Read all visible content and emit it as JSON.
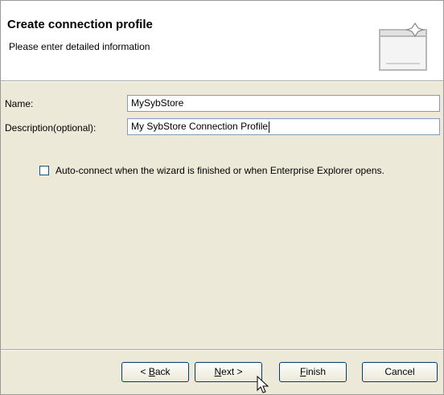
{
  "banner": {
    "title": "Create connection profile",
    "description": "Please enter detailed information",
    "icon": "wizard-banner-icon"
  },
  "form": {
    "name_label": "Name:",
    "name_value": "MySybStore",
    "description_label": "Description(optional):",
    "description_value": "My SybStore Connection Profile",
    "auto_connect_label": "Auto-connect when the wizard is finished or when Enterprise Explorer opens.",
    "auto_connect_checked": false
  },
  "buttons": {
    "back": {
      "mnemonic": "B",
      "rest": "ack",
      "prefix": "< "
    },
    "next": {
      "mnemonic": "N",
      "rest": "ext >",
      "prefix": ""
    },
    "finish": {
      "mnemonic": "F",
      "rest": "inish",
      "prefix": ""
    },
    "cancel": {
      "label": "Cancel"
    }
  },
  "colors": {
    "dialog_bg": "#ece9d8",
    "banner_bg": "#ffffff",
    "input_border": "#7f9db9",
    "button_border": "#003c74"
  }
}
